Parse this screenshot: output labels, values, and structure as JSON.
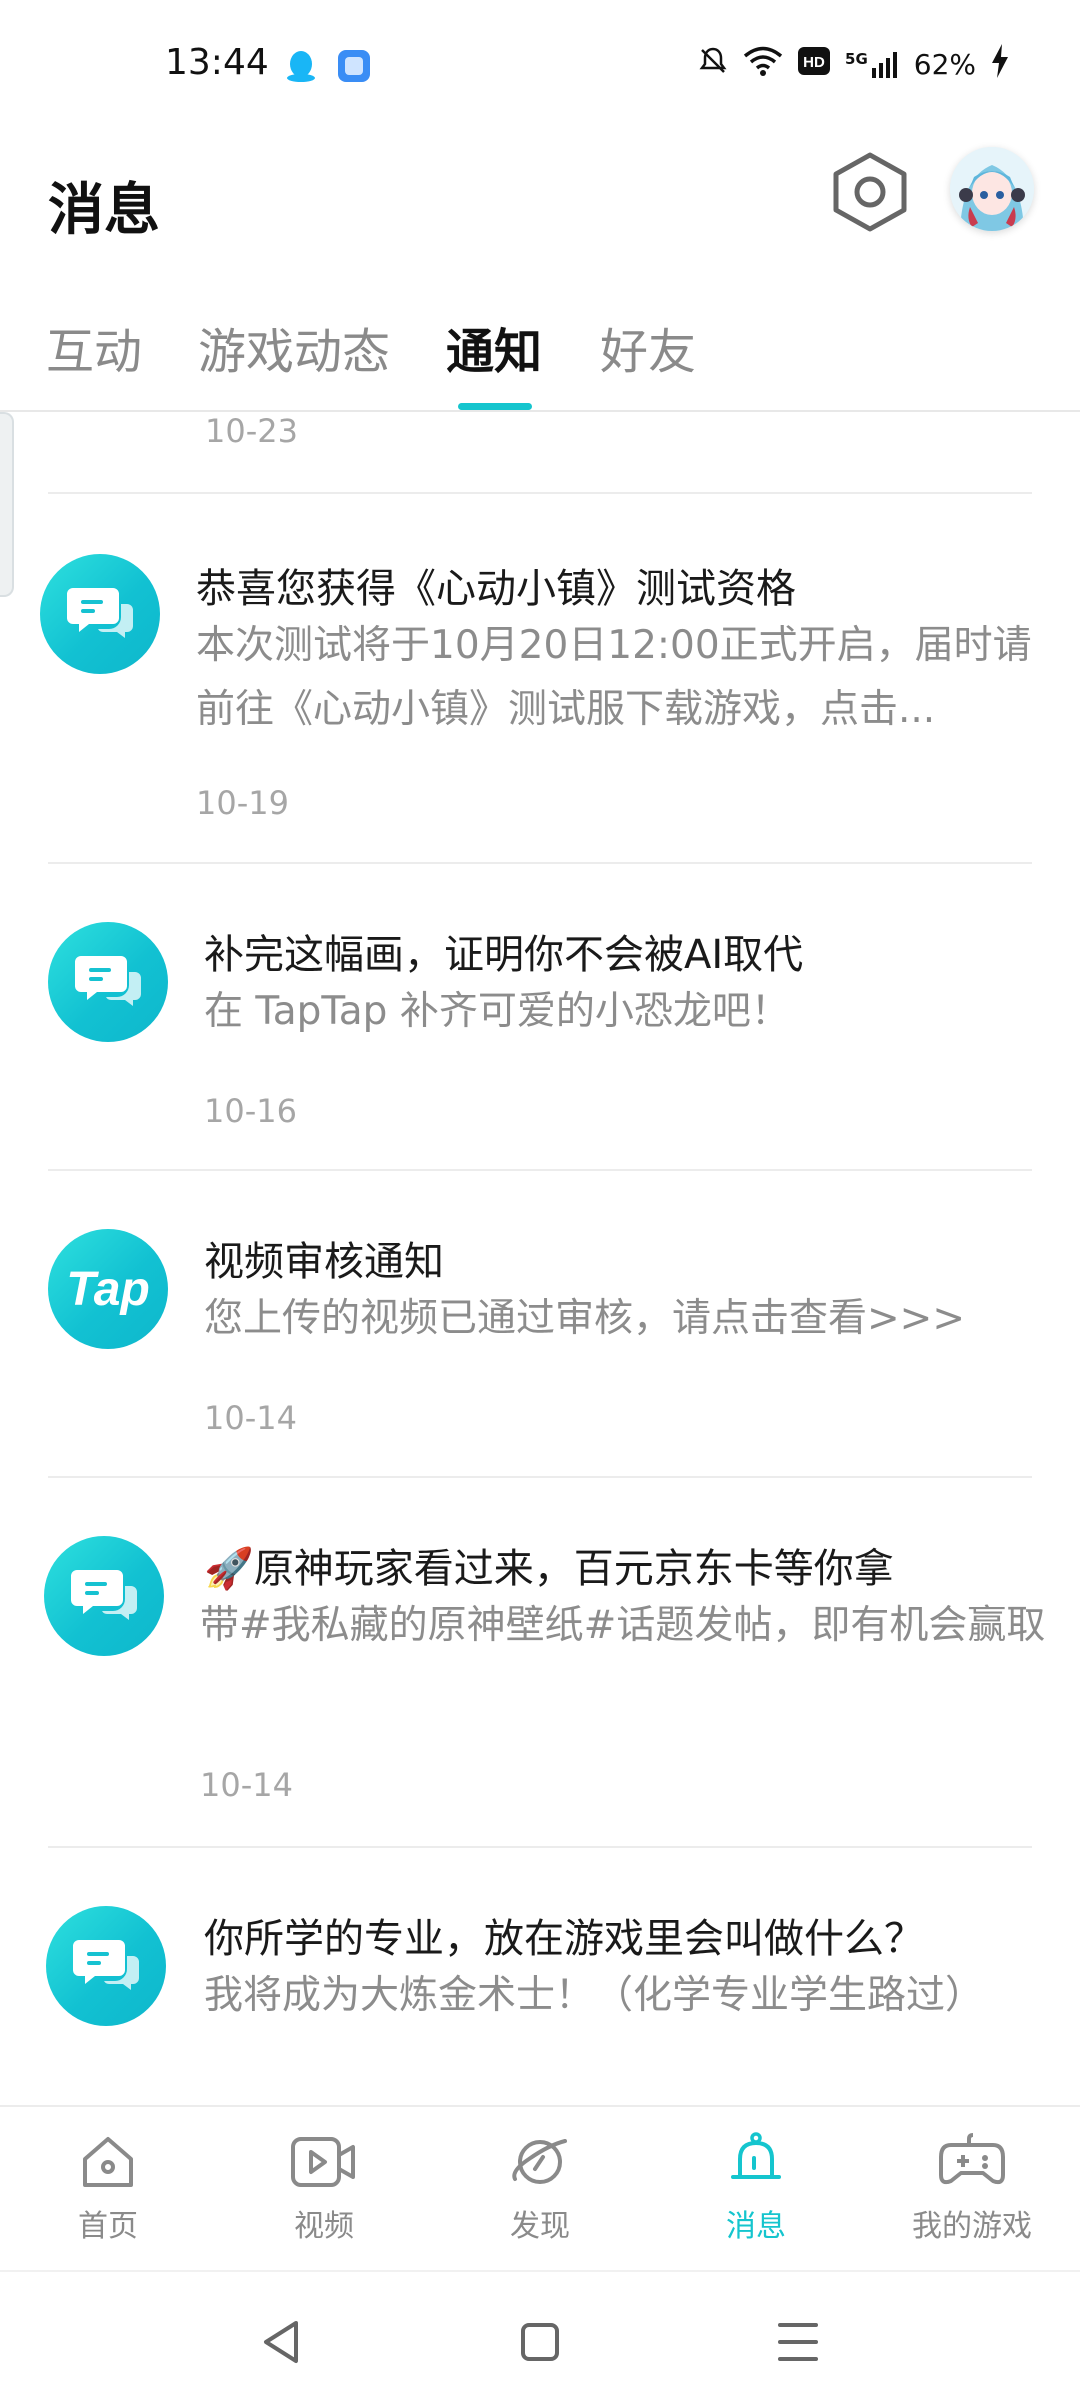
{
  "status_bar": {
    "time": "13:44",
    "network": "5G",
    "battery": "62%",
    "icons": [
      "qq-icon",
      "app-icon",
      "mute-bell-icon",
      "wifi-icon",
      "hd-icon",
      "signal-icon",
      "charging-icon"
    ]
  },
  "header": {
    "title": "消息",
    "settings_icon": "settings-hexagon-icon",
    "avatar": "anime-avatar"
  },
  "tabs": [
    {
      "label": "互动",
      "active": false
    },
    {
      "label": "游戏动态",
      "active": false
    },
    {
      "label": "通知",
      "active": true
    },
    {
      "label": "好友",
      "active": false
    }
  ],
  "feed": {
    "top_date": "10-23",
    "messages": [
      {
        "icon": "chat-bubble-icon",
        "title": "恭喜您获得《心动小镇》测试资格",
        "body": "本次测试将于10月20日12:00正式开启，届时请前往《心动小镇》测试服下载游戏，点击...",
        "date": "10-19"
      },
      {
        "icon": "chat-bubble-icon",
        "title": "补完这幅画，证明你不会被AI取代",
        "body": "在 TapTap 补齐可爱的小恐龙吧！",
        "date": "10-16"
      },
      {
        "icon": "taptap-logo-icon",
        "logo_text": "Tap",
        "title": "视频审核通知",
        "body": "您上传的视频已通过审核，请点击查看>>>",
        "date": "10-14"
      },
      {
        "icon": "chat-bubble-icon",
        "title_emoji": "🚀",
        "title": "原神玩家看过来，百元京东卡等你拿",
        "body": "带#我私藏的原神壁纸#话题发帖，即有机会赢取",
        "date": "10-14"
      },
      {
        "icon": "chat-bubble-icon",
        "title": "你所学的专业，放在游戏里会叫做什么？",
        "body": "我将成为大炼金术士！（化学专业学生路过）",
        "date": ""
      }
    ]
  },
  "bottom_nav": [
    {
      "label": "首页",
      "icon": "home-icon",
      "active": false
    },
    {
      "label": "视频",
      "icon": "video-icon",
      "active": false
    },
    {
      "label": "发现",
      "icon": "planet-icon",
      "active": false
    },
    {
      "label": "消息",
      "icon": "bell-icon",
      "active": true
    },
    {
      "label": "我的游戏",
      "icon": "gamepad-icon",
      "active": false
    }
  ],
  "colors": {
    "accent": "#15c5ce",
    "text_primary": "#1a1a1a",
    "text_secondary": "#8c8c8c",
    "text_date": "#a6a6a6"
  }
}
